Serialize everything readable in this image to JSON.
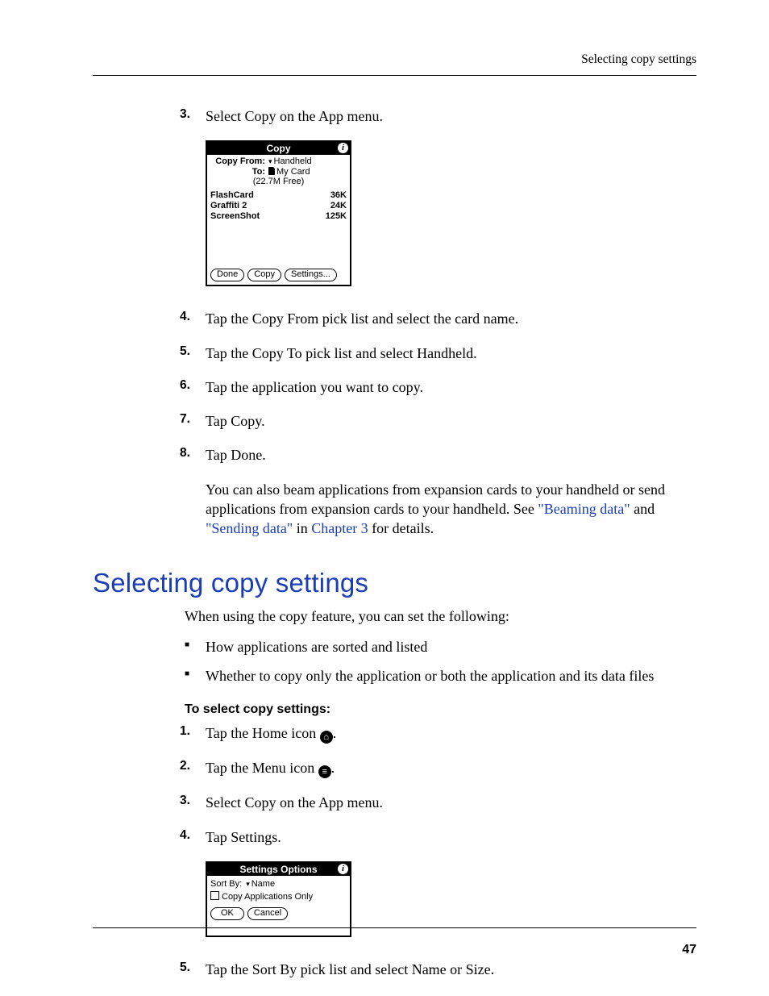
{
  "header": {
    "title": "Selecting copy settings"
  },
  "page_number": "47",
  "stepsA": [
    {
      "n": "3.",
      "text": "Select Copy on the App menu."
    },
    {
      "n": "4.",
      "text": "Tap the Copy From pick list and select the card name."
    },
    {
      "n": "5.",
      "text": "Tap the Copy To pick list and select Handheld."
    },
    {
      "n": "6.",
      "text": "Tap the application you want to copy."
    },
    {
      "n": "7.",
      "text": "Tap Copy."
    },
    {
      "n": "8.",
      "text": "Tap Done."
    }
  ],
  "after8": {
    "pre": "You can also beam applications from expansion cards to your handheld or send applications from expansion cards to your handheld. See ",
    "link1": "\"Beaming data\"",
    "mid1": " and ",
    "link2": "\"Sending data\"",
    "mid2": " in ",
    "link3": "Chapter 3",
    "post": " for details."
  },
  "section_heading": "Selecting copy settings",
  "intro": "When using the copy feature, you can set the following:",
  "bullets": [
    "How applications are sorted and listed",
    "Whether to copy only the application or both the application and its data files"
  ],
  "subhead": "To select copy settings:",
  "stepsB": [
    {
      "n": "1.",
      "pre": "Tap the Home icon ",
      "icon": "home",
      "post": "."
    },
    {
      "n": "2.",
      "pre": "Tap the Menu icon ",
      "icon": "menu",
      "post": "."
    },
    {
      "n": "3.",
      "text": "Select Copy on the App menu."
    },
    {
      "n": "4.",
      "text": "Tap Settings."
    },
    {
      "n": "5.",
      "text": "Tap the Sort By pick list and select Name or Size."
    }
  ],
  "palm_copy": {
    "title": "Copy",
    "from_label": "Copy From:",
    "from_value": "Handheld",
    "to_label": "To:",
    "to_value": "My Card",
    "free": "(22.7M Free)",
    "files": [
      {
        "name": "FlashCard",
        "size": "36K"
      },
      {
        "name": "Graffiti 2",
        "size": "24K"
      },
      {
        "name": "ScreenShot",
        "size": "125K"
      }
    ],
    "buttons": [
      "Done",
      "Copy",
      "Settings..."
    ]
  },
  "palm_settings": {
    "title": "Settings Options",
    "sort_label": "Sort By:",
    "sort_value": "Name",
    "check_label": "Copy Applications Only",
    "buttons": [
      "OK",
      "Cancel"
    ]
  }
}
